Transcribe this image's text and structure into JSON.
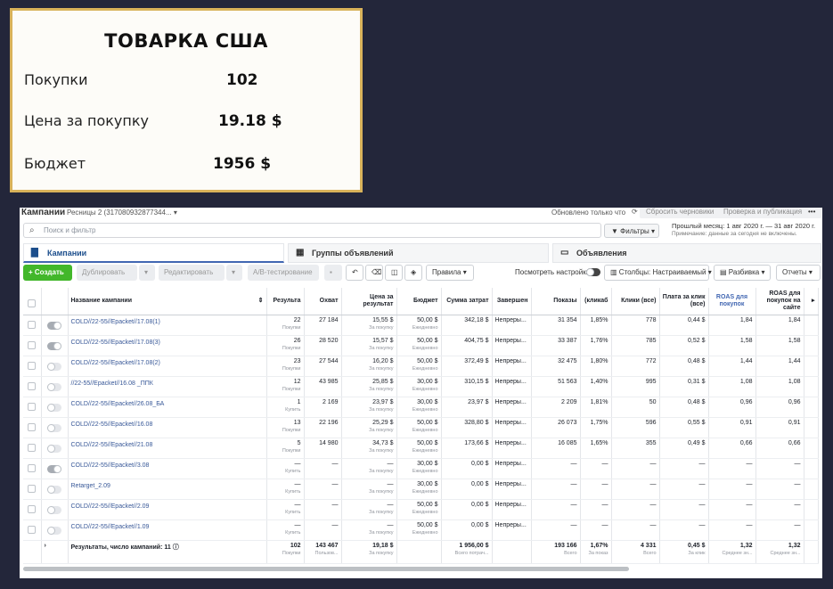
{
  "card": {
    "title": "ТОВАРКА США",
    "stats": [
      {
        "label": "Покупки",
        "value": "102"
      },
      {
        "label": "Цена за покупку",
        "value": "19.18 $"
      },
      {
        "label": "Бюджет",
        "value": "1956 $"
      }
    ]
  },
  "header": {
    "section": "Кампании",
    "account": "Ресницы 2 (317080932877344...",
    "note": "Обновлено только что",
    "discard": "Сбросить черновики",
    "review": "Проверка и публикация",
    "more": "•••"
  },
  "search": {
    "placeholder": "Поиск и фильтр"
  },
  "filters_label": "Фильтры",
  "daterange": {
    "main": "Прошлый месяц: 1 авг 2020 г. — 31 авг 2020 г.",
    "sub": "Примечание: данные за сегодня не включены."
  },
  "tabs": [
    "Кампании",
    "Группы объявлений",
    "Объявления"
  ],
  "toolbar": {
    "create": "+ Создать",
    "duplicate": "Дублировать",
    "edit": "Редактировать",
    "ab": "A/B-тестирование",
    "rules": "Правила",
    "view_settings": "Посмотреть настройки",
    "columns": "Столбцы: Настраиваемый",
    "breakdown": "Разбивка",
    "reports": "Отчеты"
  },
  "table": {
    "headers": [
      "Название кампании",
      "Результа",
      "Охват",
      "Цена за результат",
      "Бюджет",
      "Сумма затрат",
      "Завершен",
      "Показы",
      "(кликаб",
      "Клики (все)",
      "Плата за клик (все)",
      "ROAS для покупок",
      "ROAS для покупок на сайте"
    ],
    "rows": [
      {
        "toggle": "on",
        "name": "COLD//22-55//Epacket//17.08(1)",
        "res": "22",
        "res_sub": "Покупки",
        "reach": "27 184",
        "cpr": "15,55 $",
        "cpr_sub": "За покупку",
        "budget": "50,00 $",
        "budget_sub": "Ежедневно",
        "spent": "342,18 $",
        "ends": "Непреры...",
        "impr": "31 354",
        "ctr": "1,85%",
        "clicks": "778",
        "cpc": "0,44 $",
        "roas": "1,84",
        "roas_site": "1,84"
      },
      {
        "toggle": "on",
        "name": "COLD//22-55//Epacket//17.08(3)",
        "res": "26",
        "res_sub": "Покупки",
        "reach": "28 520",
        "cpr": "15,57 $",
        "cpr_sub": "За покупку",
        "budget": "50,00 $",
        "budget_sub": "Ежедневно",
        "spent": "404,75 $",
        "ends": "Непреры...",
        "impr": "33 387",
        "ctr": "1,76%",
        "clicks": "785",
        "cpc": "0,52 $",
        "roas": "1,58",
        "roas_site": "1,58"
      },
      {
        "toggle": "off",
        "name": "COLD//22-55//Epacket//17.08(2)",
        "res": "23",
        "res_sub": "Покупки",
        "reach": "27 544",
        "cpr": "16,20 $",
        "cpr_sub": "За покупку",
        "budget": "50,00 $",
        "budget_sub": "Ежедневно",
        "spent": "372,49 $",
        "ends": "Непреры...",
        "impr": "32 475",
        "ctr": "1,80%",
        "clicks": "772",
        "cpc": "0,48 $",
        "roas": "1,44",
        "roas_site": "1,44"
      },
      {
        "toggle": "off",
        "name": "//22-55//Epacket//16.08 _ППК",
        "res": "12",
        "res_sub": "Покупки",
        "reach": "43 985",
        "cpr": "25,85 $",
        "cpr_sub": "За покупку",
        "budget": "30,00 $",
        "budget_sub": "Ежедневно",
        "spent": "310,15 $",
        "ends": "Непреры...",
        "impr": "51 563",
        "ctr": "1,40%",
        "clicks": "995",
        "cpc": "0,31 $",
        "roas": "1,08",
        "roas_site": "1,08"
      },
      {
        "toggle": "off",
        "name": "COLD//22-55//Epacket//26.08_БА",
        "res": "1",
        "res_sub": "Купить",
        "reach": "2 169",
        "cpr": "23,97 $",
        "cpr_sub": "За покупку",
        "budget": "30,00 $",
        "budget_sub": "Ежедневно",
        "spent": "23,97 $",
        "ends": "Непреры...",
        "impr": "2 209",
        "ctr": "1,81%",
        "clicks": "50",
        "cpc": "0,48 $",
        "roas": "0,96",
        "roas_site": "0,96"
      },
      {
        "toggle": "off",
        "name": "COLD//22-55//Epacket//16.08",
        "res": "13",
        "res_sub": "Покупки",
        "reach": "22 196",
        "cpr": "25,29 $",
        "cpr_sub": "За покупку",
        "budget": "50,00 $",
        "budget_sub": "Ежедневно",
        "spent": "328,80 $",
        "ends": "Непреры...",
        "impr": "26 073",
        "ctr": "1,75%",
        "clicks": "596",
        "cpc": "0,55 $",
        "roas": "0,91",
        "roas_site": "0,91"
      },
      {
        "toggle": "off",
        "name": "COLD//22-55//Epacket//21.08",
        "res": "5",
        "res_sub": "Покупки",
        "reach": "14 980",
        "cpr": "34,73 $",
        "cpr_sub": "За покупку",
        "budget": "50,00 $",
        "budget_sub": "Ежедневно",
        "spent": "173,66 $",
        "ends": "Непреры...",
        "impr": "16 085",
        "ctr": "1,65%",
        "clicks": "355",
        "cpc": "0,49 $",
        "roas": "0,66",
        "roas_site": "0,66"
      },
      {
        "toggle": "on",
        "name": "COLD//22-55//Epacket//3.08",
        "res": "—",
        "res_sub": "Купить",
        "reach": "—",
        "cpr": "—",
        "cpr_sub": "За покупку",
        "budget": "30,00 $",
        "budget_sub": "Ежедневно",
        "spent": "0,00 $",
        "ends": "Непреры...",
        "impr": "—",
        "ctr": "—",
        "clicks": "—",
        "cpc": "—",
        "roas": "—",
        "roas_site": "—"
      },
      {
        "toggle": "off",
        "name": "Retarget_2.09",
        "res": "—",
        "res_sub": "Купить",
        "reach": "—",
        "cpr": "—",
        "cpr_sub": "За покупку",
        "budget": "30,00 $",
        "budget_sub": "Ежедневно",
        "spent": "0,00 $",
        "ends": "Непреры...",
        "impr": "—",
        "ctr": "—",
        "clicks": "—",
        "cpc": "—",
        "roas": "—",
        "roas_site": "—"
      },
      {
        "toggle": "off",
        "name": "COLD//22-55//Epacket//2.09",
        "res": "—",
        "res_sub": "Купить",
        "reach": "—",
        "cpr": "—",
        "cpr_sub": "За покупку",
        "budget": "50,00 $",
        "budget_sub": "Ежедневно",
        "spent": "0,00 $",
        "ends": "Непреры...",
        "impr": "—",
        "ctr": "—",
        "clicks": "—",
        "cpc": "—",
        "roas": "—",
        "roas_site": "—"
      },
      {
        "toggle": "off",
        "name": "COLD//22-55//Epacket//1.09",
        "res": "—",
        "res_sub": "Купить",
        "reach": "—",
        "cpr": "—",
        "cpr_sub": "За покупку",
        "budget": "50,00 $",
        "budget_sub": "Ежедневно",
        "spent": "0,00 $",
        "ends": "Непреры...",
        "impr": "—",
        "ctr": "—",
        "clicks": "—",
        "cpc": "—",
        "roas": "—",
        "roas_site": "—"
      }
    ],
    "total": {
      "label": "Результаты, число кампаний: 11",
      "res": "102",
      "res_sub": "Покупки",
      "reach": "143 467",
      "reach_sub": "Пользов...",
      "cpr": "19,18 $",
      "cpr_sub": "За покупку",
      "spent": "1 956,00 $",
      "spent_sub": "Всего потрач...",
      "impr": "193 166",
      "impr_sub": "Всего",
      "ctr": "1,67%",
      "ctr_sub": "За показ",
      "clicks": "4 331",
      "clicks_sub": "Всего",
      "cpc": "0,45 $",
      "cpc_sub": "За клик",
      "roas": "1,32",
      "roas_sub": "Среднее зн...",
      "roas_site": "1,32",
      "roas_site_sub": "Среднее зн..."
    }
  }
}
